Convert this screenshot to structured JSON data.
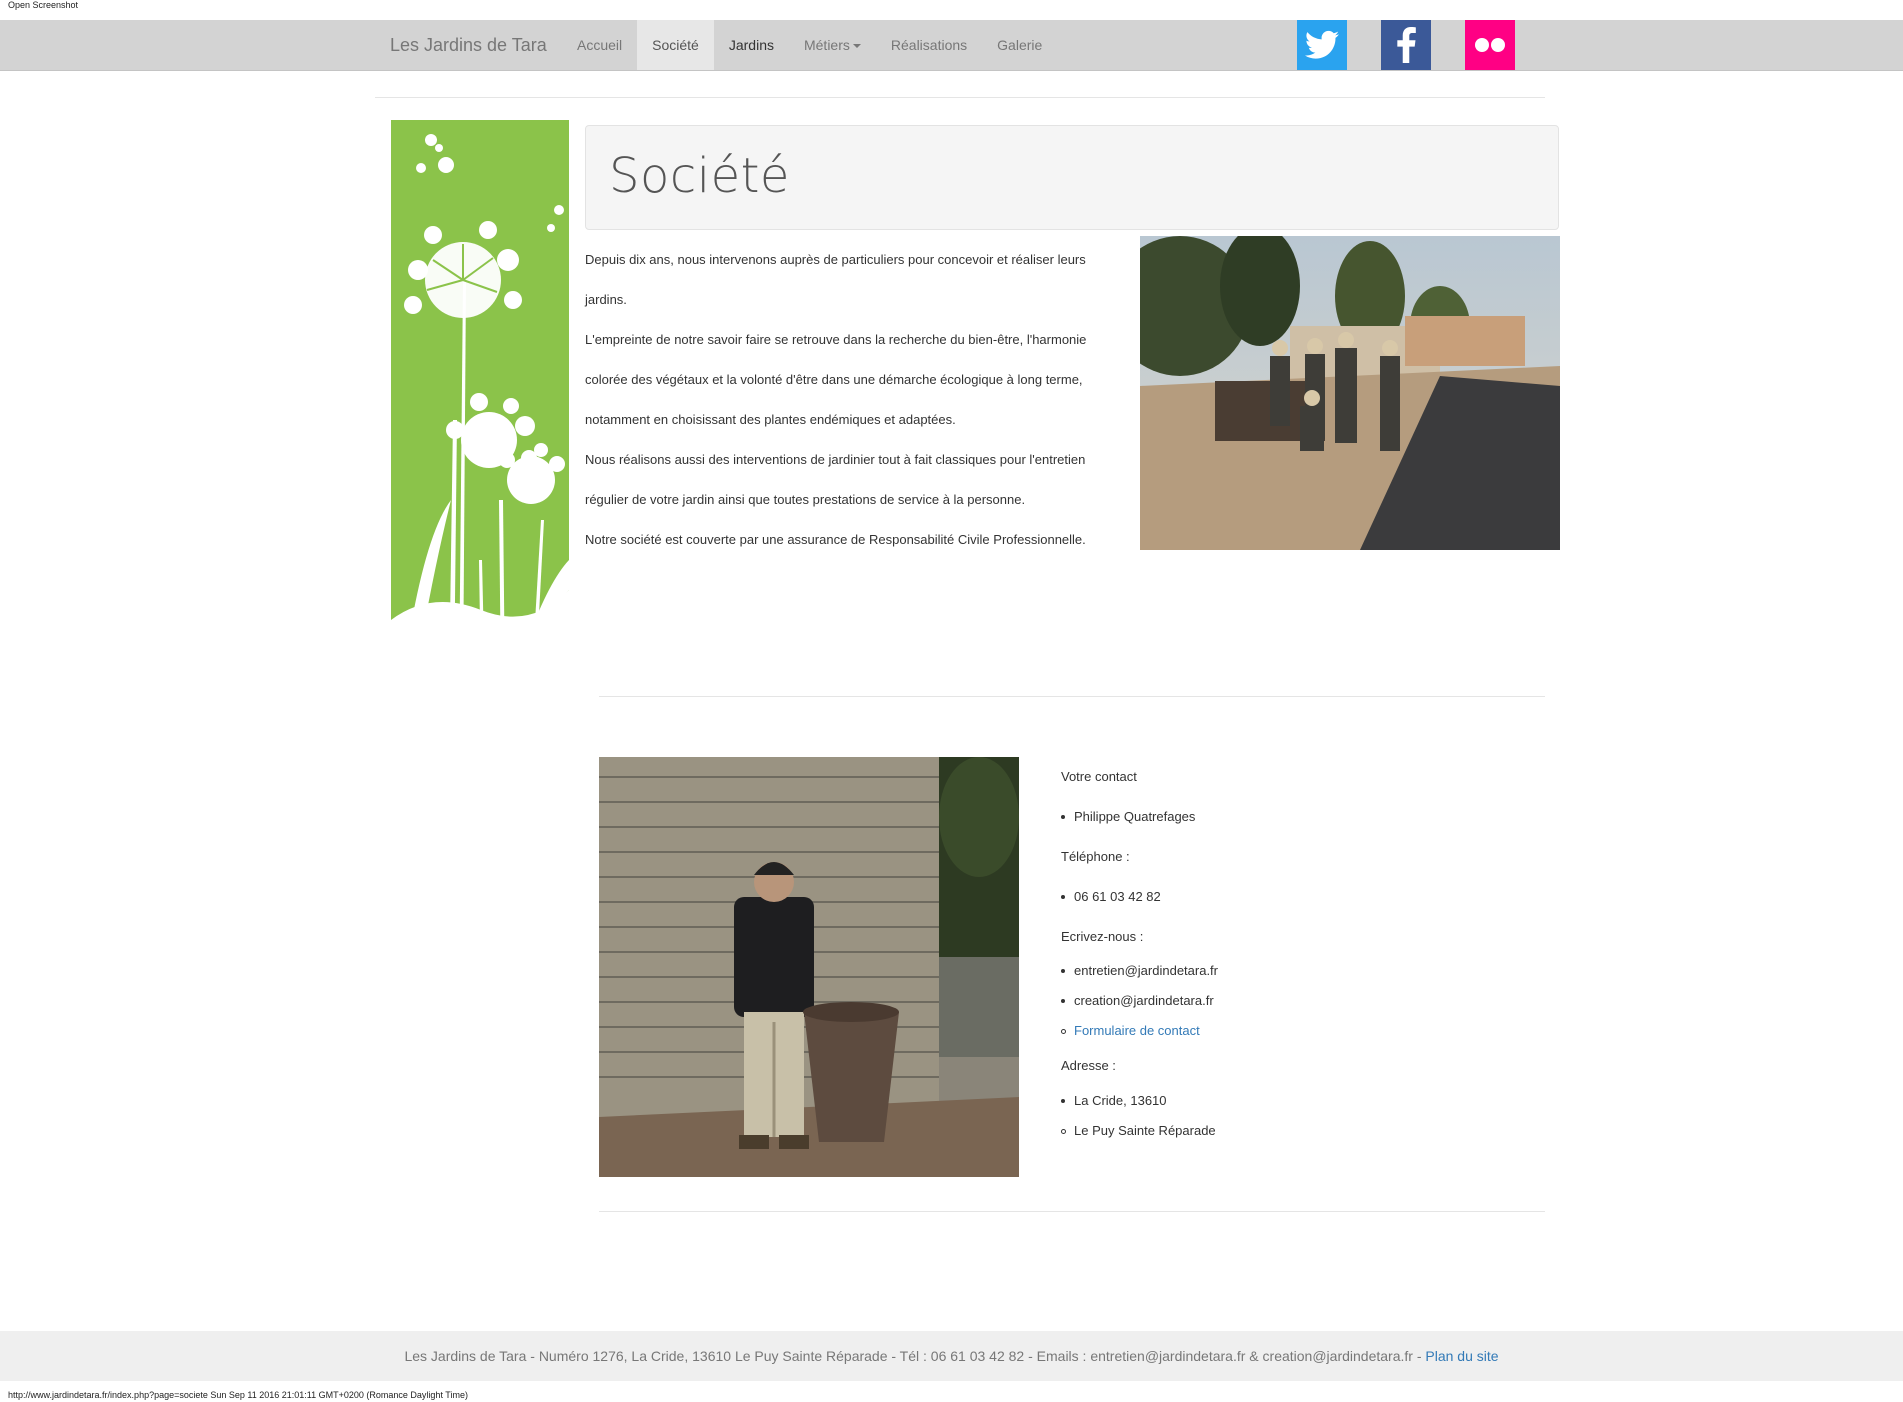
{
  "window": {
    "top_caption": "Open Screenshot"
  },
  "nav": {
    "brand": "Les Jardins de Tara",
    "items": [
      {
        "label": "Accueil"
      },
      {
        "label": "Société"
      },
      {
        "label": "Jardins"
      },
      {
        "label": "Métiers"
      },
      {
        "label": "Réalisations"
      },
      {
        "label": "Galerie"
      }
    ],
    "social": [
      "twitter-icon",
      "facebook-icon",
      "flickr-icon"
    ]
  },
  "page": {
    "title": "Société",
    "intro": [
      "Depuis dix ans, nous intervenons auprès de particuliers pour concevoir et réaliser leurs jardins.",
      "L'empreinte de notre savoir faire se retrouve dans la recherche du bien-être, l'harmonie colorée des végétaux et la volonté d'être dans une démarche écologique à long terme, notamment en choisissant des plantes endémiques et adaptées.",
      "Nous réalisons aussi des interventions de jardinier tout à fait classiques pour l'entretien régulier de votre jardin ainsi que toutes prestations de service à la personne.",
      "Notre société est couverte par une assurance de Responsabilité Civile Professionnelle."
    ]
  },
  "contact": {
    "heading_contact": "Votre contact",
    "name": "Philippe Quatrefages",
    "heading_phone": "Téléphone :",
    "phone": "06 61 03 42 82",
    "heading_email": "Ecrivez-nous :",
    "email1": "entretien@jardindetara.fr",
    "email2": "creation@jardindetara.fr",
    "form_link": "Formulaire de contact",
    "heading_address": "Adresse :",
    "address1": "La Cride, 13610",
    "address2": "Le Puy Sainte Réparade"
  },
  "footer": {
    "text": "Les Jardins de Tara - Numéro 1276, La Cride, 13610 Le Puy Sainte Réparade - Tél : 06 61 03 42 82 - Emails : entretien@jardindetara.fr & creation@jardindetara.fr - ",
    "sitemap": "Plan du site"
  },
  "status_bar": "http://www.jardindetara.fr/index.php?page=societe Sun Sep 11 2016 21:01:11 GMT+0200 (Romance Daylight Time)"
}
